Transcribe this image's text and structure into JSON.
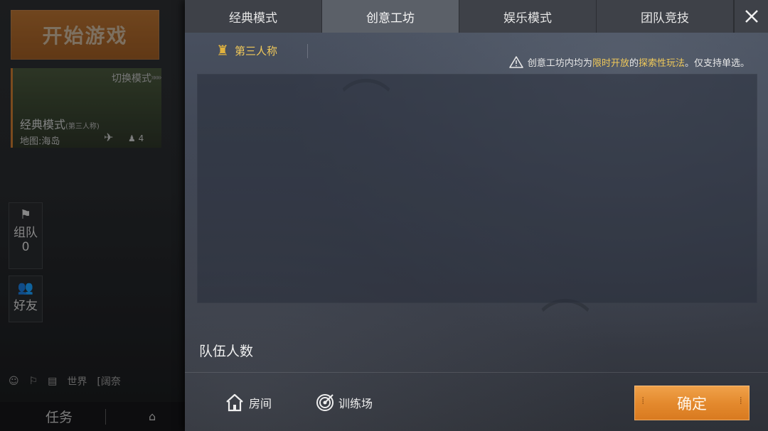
{
  "lobby": {
    "start_game": "开始游戏",
    "mode_card": {
      "switch_label": "切换模式",
      "mode_name": "经典模式",
      "mode_sub": "(第三人称)",
      "map": "地图:海岛",
      "players": "4"
    },
    "team_button": {
      "label": "组队",
      "count": "0"
    },
    "friends_button": {
      "label": "好友"
    },
    "chat": {
      "channel": "世界",
      "preview": "[阔奈"
    },
    "bottom": {
      "task": "任务"
    }
  },
  "tabs": [
    {
      "label": "经典模式",
      "active": false
    },
    {
      "label": "创意工坊",
      "active": true
    },
    {
      "label": "娱乐模式",
      "active": false
    },
    {
      "label": "团队竞技",
      "active": false
    }
  ],
  "perspective": {
    "label": "第三人称"
  },
  "notice": {
    "prefix": "创意工坊内均为",
    "highlight1": "限时开放",
    "middle": "的",
    "highlight2": "探索性玩法",
    "suffix": "。仅支持单选。"
  },
  "team_size_label": "队伍人数",
  "footer": {
    "room": "房间",
    "training": "训练场",
    "confirm": "确定"
  },
  "colors": {
    "accent_orange": "#e48a2e",
    "highlight_yellow": "#f0c95a"
  }
}
